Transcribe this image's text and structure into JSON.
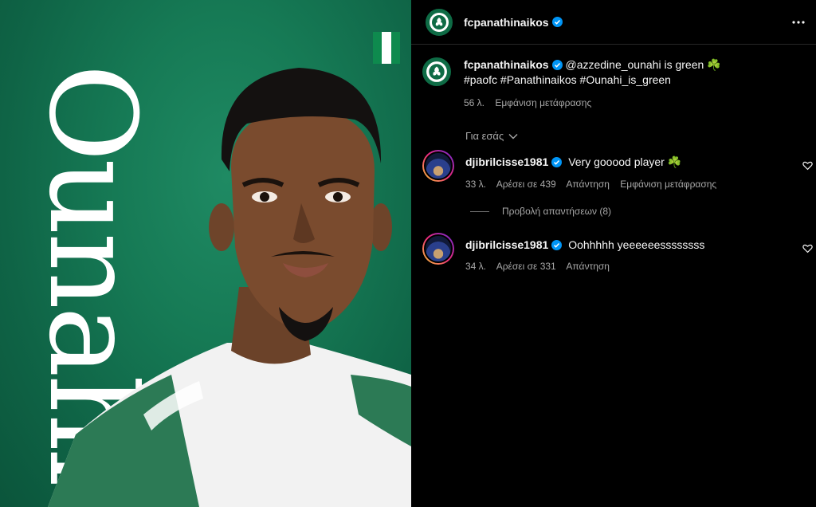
{
  "media": {
    "overlay_name": "Ounahi",
    "background_color": "#167a55"
  },
  "header": {
    "username": "fcpanathinaikos",
    "avatar_icon": "panathinaikos-crest-icon"
  },
  "caption": {
    "username": "fcpanathinaikos",
    "line1": "@azzedine_ounahi is green ☘️",
    "line2": "#paofc #Panathinaikos #Ounahi_is_green",
    "time": "56 λ.",
    "translate": "Εμφάνιση μετάφρασης"
  },
  "for_you": "Για εσάς",
  "comments": [
    {
      "username": "djibrilcisse1981",
      "text": "Very gooood player ☘️",
      "time": "33 λ.",
      "likes": "Αρέσει σε 439",
      "reply": "Απάντηση",
      "translate": "Εμφάνιση μετάφρασης"
    },
    {
      "username": "djibrilcisse1981",
      "text": "Oohhhhh yeeeeeessssssss",
      "time": "34 λ.",
      "likes": "Αρέσει σε 331",
      "reply": "Απάντηση"
    }
  ],
  "view_replies": "Προβολή απαντήσεων (8)",
  "colors": {
    "verified": "#0095f6",
    "club_green": "#0e6b45",
    "text_secondary": "#a8a8a8"
  }
}
